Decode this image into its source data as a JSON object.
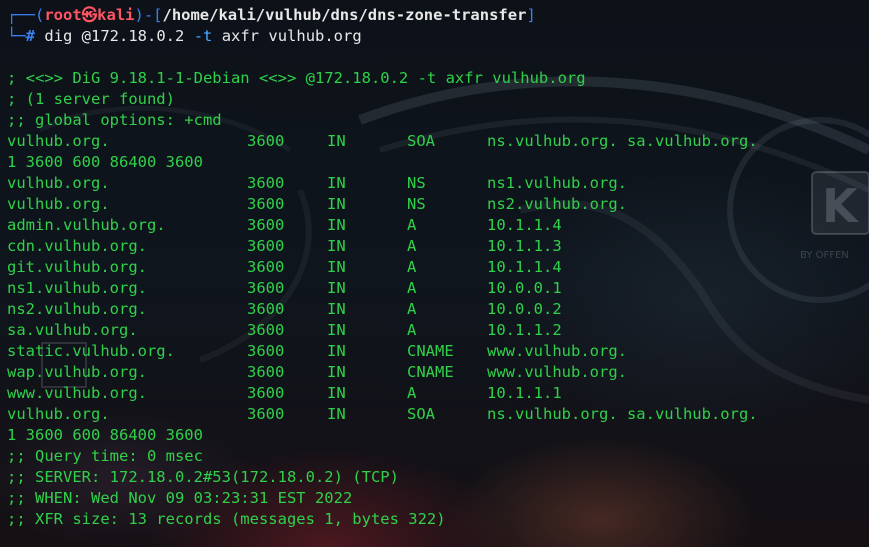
{
  "prompt": {
    "user_host_prefix": "┌──(",
    "user": "root㉿kali",
    "mid": ")-[",
    "path": "/home/kali/vulhub/dns/dns-zone-transfer",
    "end": "]",
    "line2_prefix": "└─",
    "hash": "#",
    "command": "dig @172.18.0.2",
    "option": "-t",
    "args": "axfr vulhub.org"
  },
  "output_header": [
    "; <<>> DiG 9.18.1-1-Debian <<>> @172.18.0.2 -t axfr vulhub.org",
    "; (1 server found)",
    ";; global options: +cmd"
  ],
  "records": [
    {
      "name": "vulhub.org.",
      "ttl": "3600",
      "class": "IN",
      "type": "SOA",
      "data": "ns.vulhub.org. sa.vulhub.org."
    },
    {
      "continuation": "1 3600 600 86400 3600"
    },
    {
      "name": "vulhub.org.",
      "ttl": "3600",
      "class": "IN",
      "type": "NS",
      "data": "ns1.vulhub.org."
    },
    {
      "name": "vulhub.org.",
      "ttl": "3600",
      "class": "IN",
      "type": "NS",
      "data": "ns2.vulhub.org."
    },
    {
      "name": "admin.vulhub.org.",
      "ttl": "3600",
      "class": "IN",
      "type": "A",
      "data": "10.1.1.4"
    },
    {
      "name": "cdn.vulhub.org.",
      "ttl": "3600",
      "class": "IN",
      "type": "A",
      "data": "10.1.1.3"
    },
    {
      "name": "git.vulhub.org.",
      "ttl": "3600",
      "class": "IN",
      "type": "A",
      "data": "10.1.1.4"
    },
    {
      "name": "ns1.vulhub.org.",
      "ttl": "3600",
      "class": "IN",
      "type": "A",
      "data": "10.0.0.1"
    },
    {
      "name": "ns2.vulhub.org.",
      "ttl": "3600",
      "class": "IN",
      "type": "A",
      "data": "10.0.0.2"
    },
    {
      "name": "sa.vulhub.org.",
      "ttl": "3600",
      "class": "IN",
      "type": "A",
      "data": "10.1.1.2"
    },
    {
      "name": "static.vulhub.org.",
      "ttl": "3600",
      "class": "IN",
      "type": "CNAME",
      "data": "www.vulhub.org."
    },
    {
      "name": "wap.vulhub.org.",
      "ttl": "3600",
      "class": "IN",
      "type": "CNAME",
      "data": "www.vulhub.org."
    },
    {
      "name": "www.vulhub.org.",
      "ttl": "3600",
      "class": "IN",
      "type": "A",
      "data": "10.1.1.1"
    },
    {
      "name": "vulhub.org.",
      "ttl": "3600",
      "class": "IN",
      "type": "SOA",
      "data": "ns.vulhub.org. sa.vulhub.org."
    },
    {
      "continuation": "1 3600 600 86400 3600"
    }
  ],
  "output_footer": [
    ";; Query time: 0 msec",
    ";; SERVER: 172.18.0.2#53(172.18.0.2) (TCP)",
    ";; WHEN: Wed Nov 09 03:23:31 EST 2022",
    ";; XFR size: 13 records (messages 1, bytes 322)"
  ],
  "colors": {
    "output_green": "#30d14a",
    "prompt_blue": "#3d7df0",
    "prompt_red": "#ff5565",
    "option_blue": "#4aa8ff"
  },
  "wallpaper": {
    "logo_text": "K",
    "logo_caption": "BY OFFEN"
  }
}
